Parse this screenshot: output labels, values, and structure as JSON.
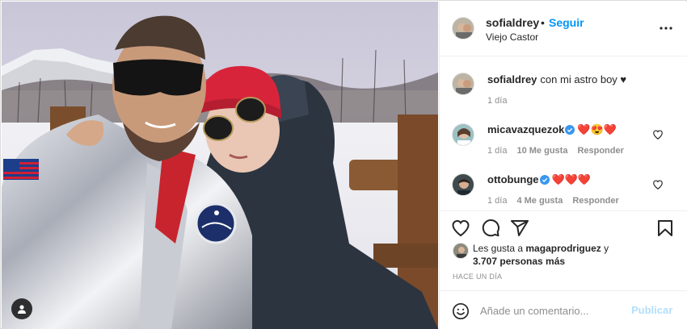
{
  "post": {
    "username": "sofialdrey",
    "follow_dot": "•",
    "follow_label": "Seguir",
    "location": "Viejo Castor"
  },
  "caption": {
    "username": "sofialdrey",
    "text": "con mi astro boy ♥",
    "time": "1 día"
  },
  "comments": [
    {
      "username": "micavazquezok",
      "verified": true,
      "text": "❤️😍❤️",
      "time": "1 día",
      "likes": "10 Me gusta",
      "reply": "Responder"
    },
    {
      "username": "ottobunge",
      "verified": true,
      "text": "❤️❤️❤️",
      "time": "1 día",
      "likes": "4 Me gusta",
      "reply": "Responder"
    }
  ],
  "likes": {
    "prefix": "Les gusta a",
    "user": "magaprodriguez",
    "conj": "y",
    "others": "3.707 personas más"
  },
  "date": "HACE UN DÍA",
  "add_comment": {
    "placeholder": "Añade un comentario...",
    "publish_label": "Publicar"
  },
  "colors": {
    "link_blue": "#0095f6",
    "publish_disabled": "#b2dffc",
    "muted": "#8e8e8e",
    "text": "#262626",
    "verified": "#3897f0"
  },
  "icons": [
    "more-options-icon",
    "heart-icon",
    "comment-icon",
    "share-icon",
    "bookmark-icon",
    "emoji-icon",
    "tag-user-icon",
    "verified-icon"
  ]
}
